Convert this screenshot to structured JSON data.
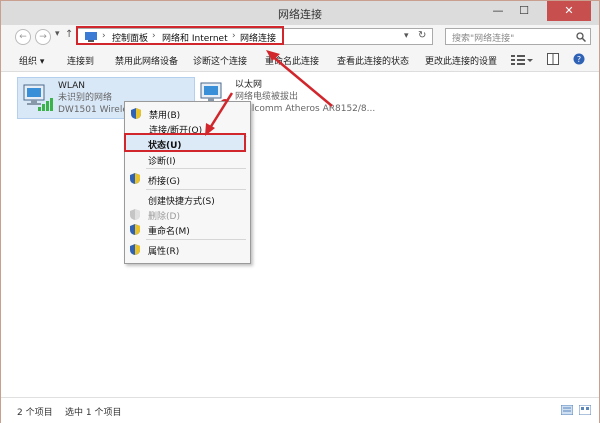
{
  "window": {
    "title": "网络连接",
    "minimize": "—",
    "maximize": "☐",
    "close": "✕"
  },
  "nav": {
    "back": "←",
    "forward": "→",
    "up": "↑",
    "breadcrumb": [
      "控制面板",
      "网络和 Internet",
      "网络连接"
    ],
    "dropdown": "▾",
    "refresh": "↻",
    "search_placeholder": "搜索\"网络连接\""
  },
  "toolbar": {
    "organize": "组织 ▾",
    "connect_to": "连接到",
    "disable_device": "禁用此网络设备",
    "diagnose": "诊断这个连接",
    "rename": "重命名此连接",
    "view_status": "查看此连接的状态",
    "change_settings": "更改此连接的设置"
  },
  "connections": [
    {
      "name": "WLAN",
      "status": "未识别的网络",
      "device": "DW1501 Wireless"
    },
    {
      "name": "以太网",
      "status": "网络电缆被拔出",
      "device": "Realcomm Atheros AR8152/8..."
    }
  ],
  "context_menu": [
    {
      "label": "禁用(B)",
      "shield": true
    },
    {
      "label": "连接/断开(O)"
    },
    {
      "label": "状态(U)",
      "bold": true
    },
    {
      "label": "诊断(I)"
    },
    {
      "label": "桥接(G)",
      "shield": true
    },
    {
      "label": "创建快捷方式(S)"
    },
    {
      "label": "删除(D)",
      "shield": true,
      "disabled": true
    },
    {
      "label": "重命名(M)",
      "shield": true
    },
    {
      "label": "属性(R)",
      "shield": true
    }
  ],
  "statusbar": {
    "items_count": "2 个项目",
    "selected": "选中 1 个项目"
  },
  "colors": {
    "highlight_red": "#d0262c",
    "selection": "#d9e8f7",
    "shield_blue": "#2f62b5",
    "shield_yellow": "#e8c22a"
  },
  "icons": [
    "search-icon",
    "refresh-icon",
    "computer-icon",
    "network-adapter-icon",
    "shield-icon",
    "view-details-icon",
    "help-icon"
  ]
}
